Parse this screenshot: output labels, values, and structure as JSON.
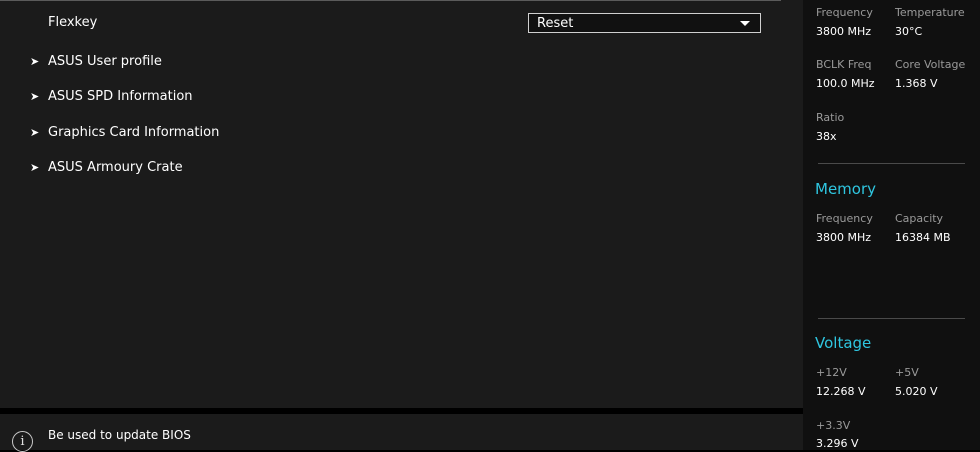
{
  "main": {
    "flexkey_label": "Flexkey",
    "flexkey_value": "Reset",
    "menu_items": [
      {
        "label": "ASUS User profile"
      },
      {
        "label": "ASUS SPD Information"
      },
      {
        "label": "Graphics Card Information"
      },
      {
        "label": "ASUS Armoury Crate"
      }
    ]
  },
  "help": {
    "text": "Be used to update BIOS",
    "icon": "info-icon"
  },
  "hw_monitor": {
    "cpu": {
      "frequency_label": "Frequency",
      "frequency_value": "3800 MHz",
      "temperature_label": "Temperature",
      "temperature_value": "30°C",
      "bclk_label": "BCLK Freq",
      "bclk_value": "100.0 MHz",
      "core_voltage_label": "Core Voltage",
      "core_voltage_value": "1.368 V",
      "ratio_label": "Ratio",
      "ratio_value": "38x"
    },
    "memory": {
      "title": "Memory",
      "frequency_label": "Frequency",
      "frequency_value": "3800 MHz",
      "capacity_label": "Capacity",
      "capacity_value": "16384 MB"
    },
    "voltage": {
      "title": "Voltage",
      "v12_label": "+12V",
      "v12_value": "12.268 V",
      "v5_label": "+5V",
      "v5_value": "5.020 V",
      "v33_label": "+3.3V",
      "v33_value": "3.296 V"
    }
  },
  "colors": {
    "accent": "#2fc6e0",
    "panel_bg": "#1b1b1b",
    "sidebar_bg": "#101010"
  }
}
